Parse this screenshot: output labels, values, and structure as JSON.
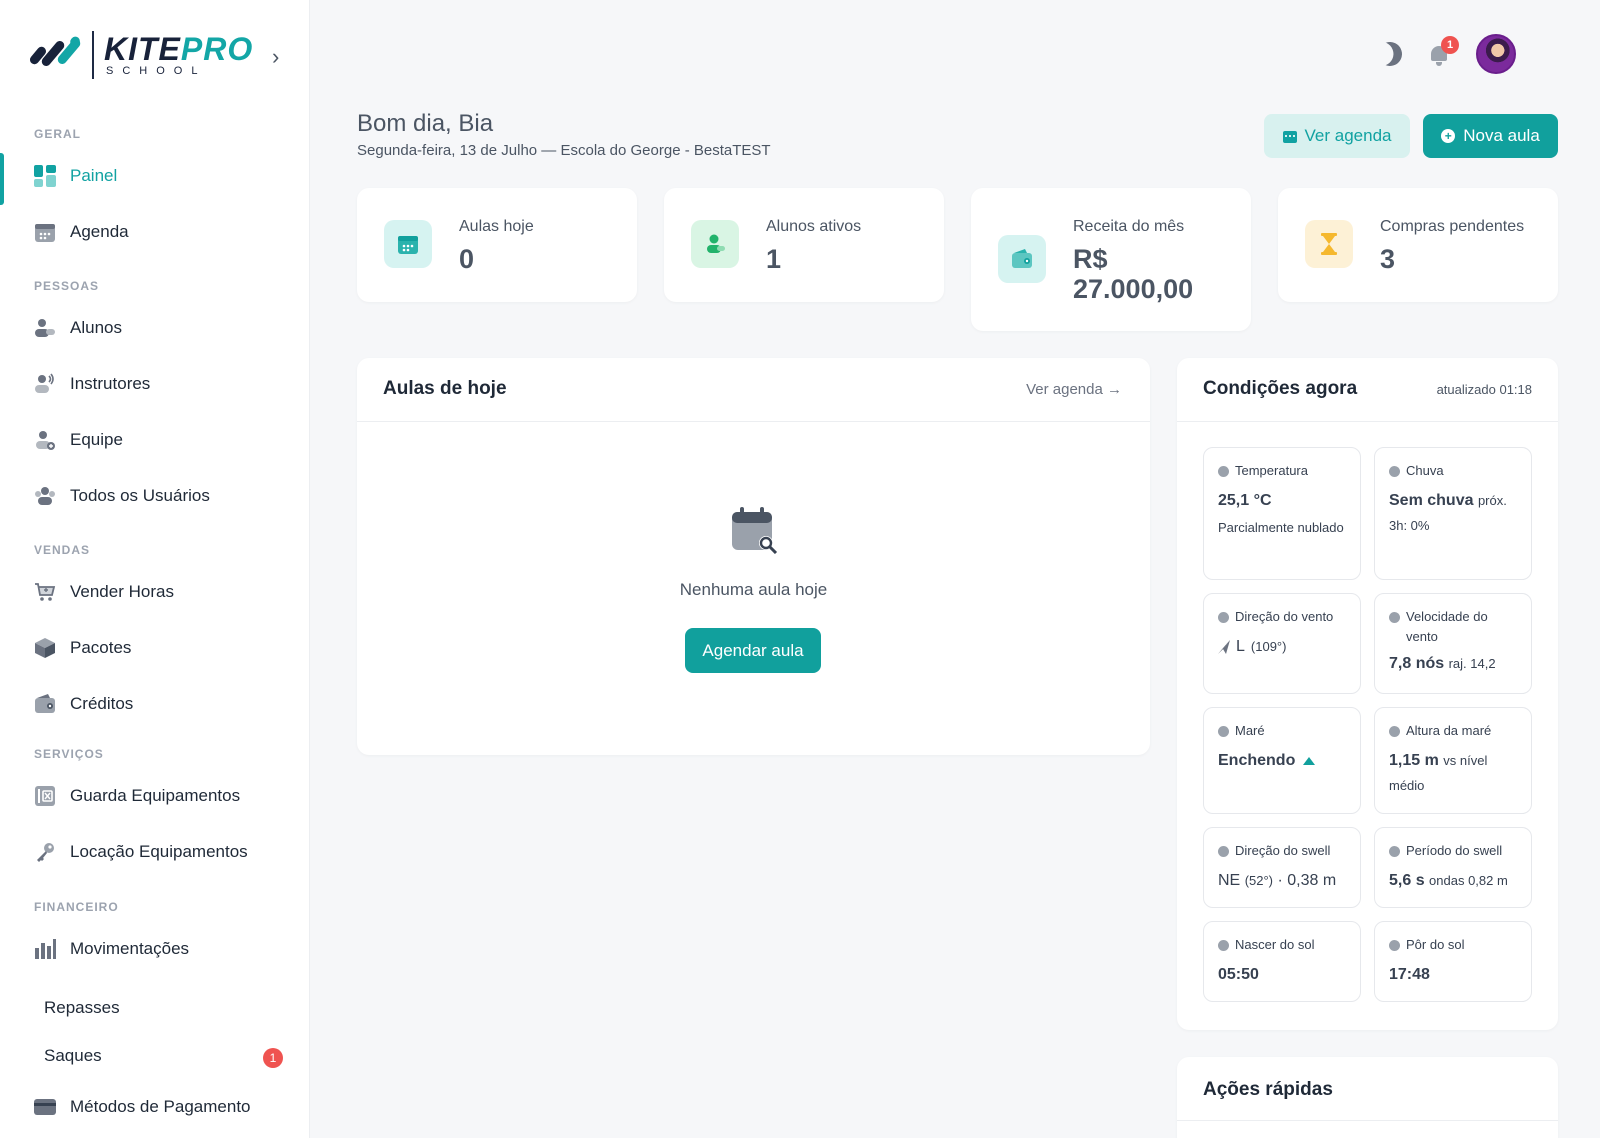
{
  "brand": {
    "name_part1": "KITE",
    "name_part2": "PRO",
    "sub": "SCHOOL",
    "accent": "#11a09d",
    "dark": "#18223a"
  },
  "sidebar": {
    "sections": {
      "geral": "GERAL",
      "pessoas": "PESSOAS",
      "vendas": "VENDAS",
      "servicos": "SERVIÇOS",
      "financeiro": "FINANCEIRO"
    },
    "items": {
      "painel": "Painel",
      "agenda": "Agenda",
      "alunos": "Alunos",
      "instrutores": "Instrutores",
      "equipe": "Equipe",
      "todos_usuarios": "Todos os Usuários",
      "vender_horas": "Vender Horas",
      "pacotes": "Pacotes",
      "creditos": "Créditos",
      "guarda": "Guarda Equipamentos",
      "locacao": "Locação Equipamentos",
      "movimentacoes": "Movimentações",
      "repasses": "Repasses",
      "saques": "Saques",
      "saques_badge": "1",
      "metodos": "Métodos de Pagamento"
    }
  },
  "topbar": {
    "notifications_count": "1"
  },
  "header": {
    "greeting": "Bom dia, Bia",
    "subtitle": "Segunda-feira, 13 de Julho — Escola do George - BestaTEST",
    "ver_agenda": "Ver agenda",
    "nova_aula": "Nova aula"
  },
  "stats": [
    {
      "label": "Aulas hoje",
      "value": "0"
    },
    {
      "label": "Alunos ativos",
      "value": "1"
    },
    {
      "label": "Receita do mês",
      "value_line1": "R$",
      "value_line2": "27.000,00"
    },
    {
      "label": "Compras pendentes",
      "value": "3"
    }
  ],
  "aulas": {
    "title": "Aulas de hoje",
    "link": "Ver agenda →",
    "empty": "Nenhuma aula hoje",
    "button": "Agendar aula"
  },
  "conditions": {
    "title": "Condições agora",
    "updated": "atualizado 01:18",
    "temperatura": {
      "label": "Temperatura",
      "value": "25,1 °C",
      "desc": "Parcialmente nublado"
    },
    "chuva": {
      "label": "Chuva",
      "value": "Sem chuva",
      "desc": "próx. 3h: 0%"
    },
    "dir_vento": {
      "label": "Direção do vento",
      "value": "L",
      "desc": "(109°)"
    },
    "vel_vento": {
      "label": "Velocidade do vento",
      "value": "7,8 nós",
      "desc": "raj. 14,2"
    },
    "mare": {
      "label": "Maré",
      "value": "Enchendo"
    },
    "altura_mare": {
      "label": "Altura da maré",
      "value": "1,15 m",
      "desc": "vs nível médio"
    },
    "dir_swell": {
      "label": "Direção do swell",
      "value_a": "NE",
      "value_b": "(52°)",
      "value_c": "· 0,38 m"
    },
    "periodo_swell": {
      "label": "Período do swell",
      "value": "5,6 s",
      "desc": "ondas 0,82 m"
    },
    "nascer": {
      "label": "Nascer do sol",
      "value": "05:50"
    },
    "por": {
      "label": "Pôr do sol",
      "value": "17:48"
    }
  },
  "quick": {
    "title": "Ações rápidas"
  }
}
